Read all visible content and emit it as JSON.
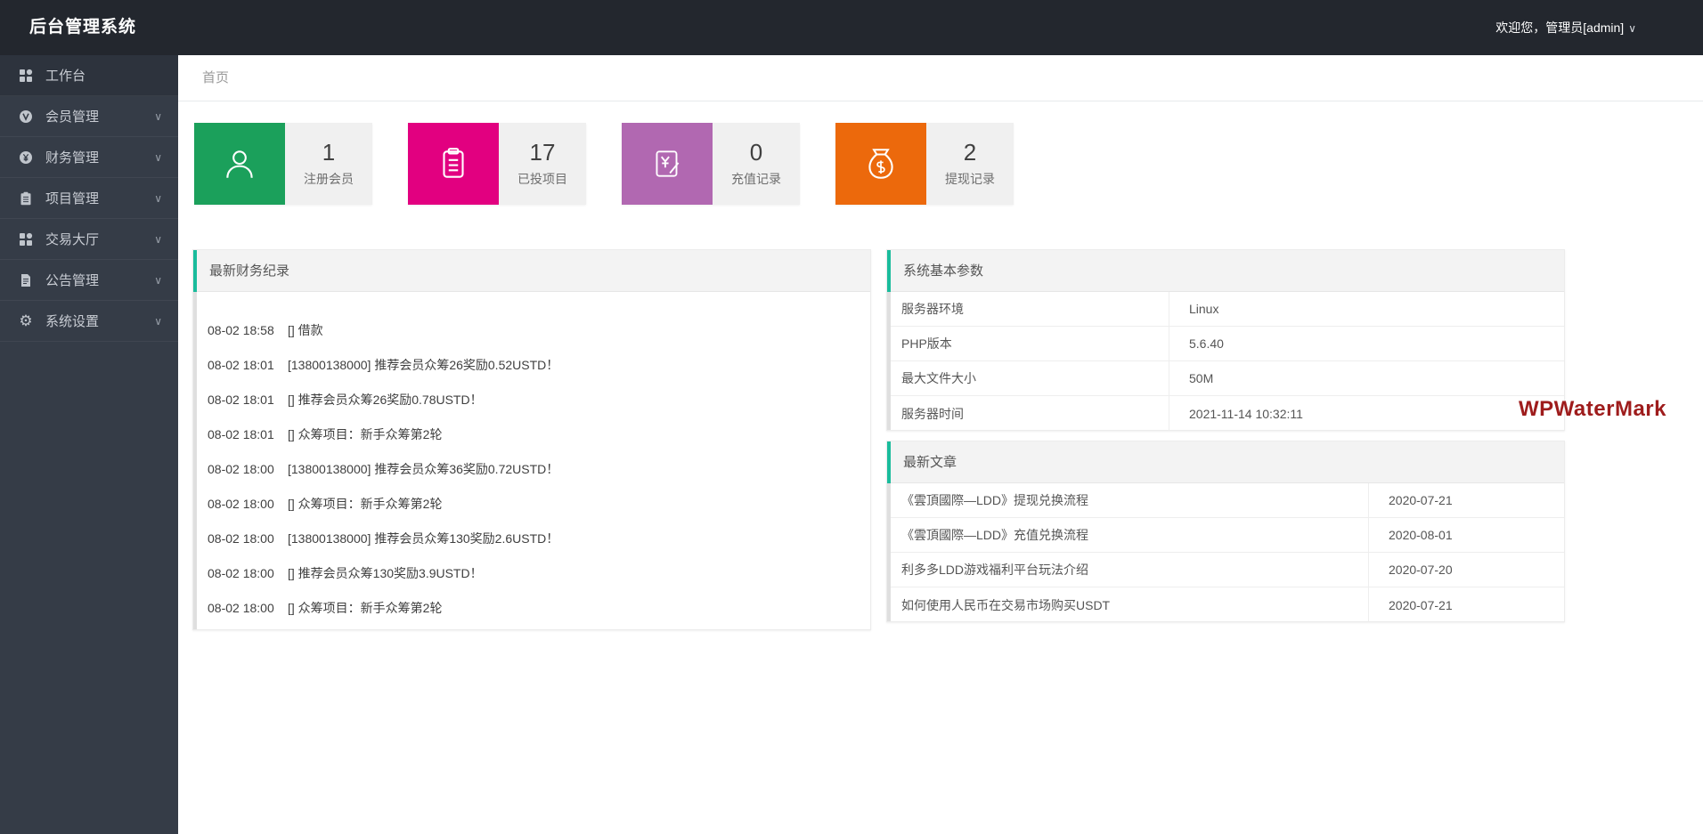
{
  "topbar": {
    "title": "后台管理系统",
    "welcome": "欢迎您，管理员[admin]"
  },
  "icons": {
    "chevron_down": "∨",
    "gear": "⚙"
  },
  "breadcrumb": {
    "home": "首页"
  },
  "sidebar": {
    "items": [
      {
        "label": "工作台",
        "icon": "dashboard-icon",
        "has_children": false
      },
      {
        "label": "会员管理",
        "icon": "member-icon",
        "has_children": true
      },
      {
        "label": "财务管理",
        "icon": "finance-icon",
        "has_children": true
      },
      {
        "label": "项目管理",
        "icon": "project-icon",
        "has_children": true
      },
      {
        "label": "交易大厅",
        "icon": "trade-icon",
        "has_children": true
      },
      {
        "label": "公告管理",
        "icon": "notice-icon",
        "has_children": true
      },
      {
        "label": "系统设置",
        "icon": "settings-icon",
        "has_children": true
      }
    ]
  },
  "stat_cards": [
    {
      "value": "1",
      "label": "注册会员",
      "color": "#1ba05b",
      "icon": "user-icon"
    },
    {
      "value": "17",
      "label": "已投项目",
      "color": "#e20080",
      "icon": "clipboard-icon"
    },
    {
      "value": "0",
      "label": "充值记录",
      "color": "#b168b1",
      "icon": "recharge-icon"
    },
    {
      "value": "2",
      "label": "提现记录",
      "color": "#ec690c",
      "icon": "moneybag-icon"
    }
  ],
  "finance_panel": {
    "title": "最新财务纪录",
    "records": [
      {
        "time": "08-02 18:58",
        "text": "[] 借款"
      },
      {
        "time": "08-02 18:01",
        "text": "[13800138000] 推荐会员众筹26奖励0.52USTD！"
      },
      {
        "time": "08-02 18:01",
        "text": "[] 推荐会员众筹26奖励0.78USTD！"
      },
      {
        "time": "08-02 18:01",
        "text": "[] 众筹项目：新手众筹第2轮"
      },
      {
        "time": "08-02 18:00",
        "text": "[13800138000] 推荐会员众筹36奖励0.72USTD！"
      },
      {
        "time": "08-02 18:00",
        "text": "[] 众筹项目：新手众筹第2轮"
      },
      {
        "time": "08-02 18:00",
        "text": "[13800138000] 推荐会员众筹130奖励2.6USTD！"
      },
      {
        "time": "08-02 18:00",
        "text": "[] 推荐会员众筹130奖励3.9USTD！"
      },
      {
        "time": "08-02 18:00",
        "text": "[] 众筹项目：新手众筹第2轮"
      }
    ]
  },
  "system_panel": {
    "title": "系统基本参数",
    "rows": [
      {
        "label": "服务器环境",
        "value": "Linux"
      },
      {
        "label": "PHP版本",
        "value": "5.6.40"
      },
      {
        "label": "最大文件大小",
        "value": "50M"
      },
      {
        "label": "服务器时间",
        "value": "2021-11-14 10:32:11"
      }
    ]
  },
  "articles_panel": {
    "title": "最新文章",
    "rows": [
      {
        "title": "《雲頂國際—LDD》提现兑换流程",
        "date": "2020-07-21"
      },
      {
        "title": "《雲頂國際—LDD》充值兑换流程",
        "date": "2020-08-01"
      },
      {
        "title": "利多多LDD游戏福利平台玩法介绍",
        "date": "2020-07-20"
      },
      {
        "title": "如何使用人民币在交易市场购买USDT",
        "date": "2020-07-21"
      }
    ]
  },
  "watermark": {
    "text": "WPWaterMark",
    "color": "#9e1c1c"
  },
  "colors": {
    "topbar_bg": "#23272e",
    "sidebar_bg": "#353c47",
    "accent_teal": "#1abc9c",
    "panel_header_bg": "#f3f3f3",
    "card_gray_bg": "#f0f0f0"
  }
}
